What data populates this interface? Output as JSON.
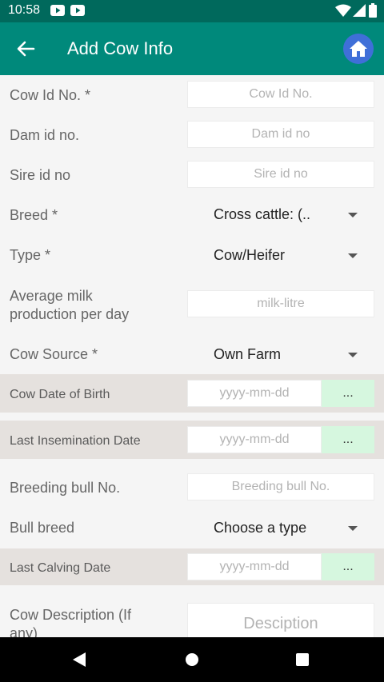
{
  "status_bar": {
    "time": "10:58"
  },
  "app_bar": {
    "title": "Add Cow Info"
  },
  "form": {
    "cow_id": {
      "label": "Cow Id No.  *",
      "placeholder": "Cow Id No."
    },
    "dam_id": {
      "label": "Dam id no.",
      "placeholder": "Dam id no"
    },
    "sire_id": {
      "label": "Sire id no",
      "placeholder": "Sire id no"
    },
    "breed": {
      "label": "Breed  *",
      "value": "Cross cattle: (.."
    },
    "type": {
      "label": "Type  *",
      "value": "Cow/Heifer"
    },
    "milk": {
      "label": "Average milk\nproduction per day",
      "placeholder": "milk-litre"
    },
    "source": {
      "label": "Cow Source *",
      "value": "Own Farm"
    },
    "dob": {
      "label": "Cow Date of Birth",
      "placeholder": "yyyy-mm-dd",
      "button": "..."
    },
    "insemination": {
      "label": "Last Insemination Date",
      "placeholder": "yyyy-mm-dd",
      "button": "..."
    },
    "breeding_bull": {
      "label": "Breeding bull No.",
      "placeholder": "Breeding bull No."
    },
    "bull_breed": {
      "label": "Bull breed",
      "value": "Choose a type"
    },
    "calving": {
      "label": "Last Calving Date",
      "placeholder": "yyyy-mm-dd",
      "button": "..."
    },
    "description": {
      "label": "Cow Description (If\nany)",
      "placeholder": "Desciption"
    }
  }
}
